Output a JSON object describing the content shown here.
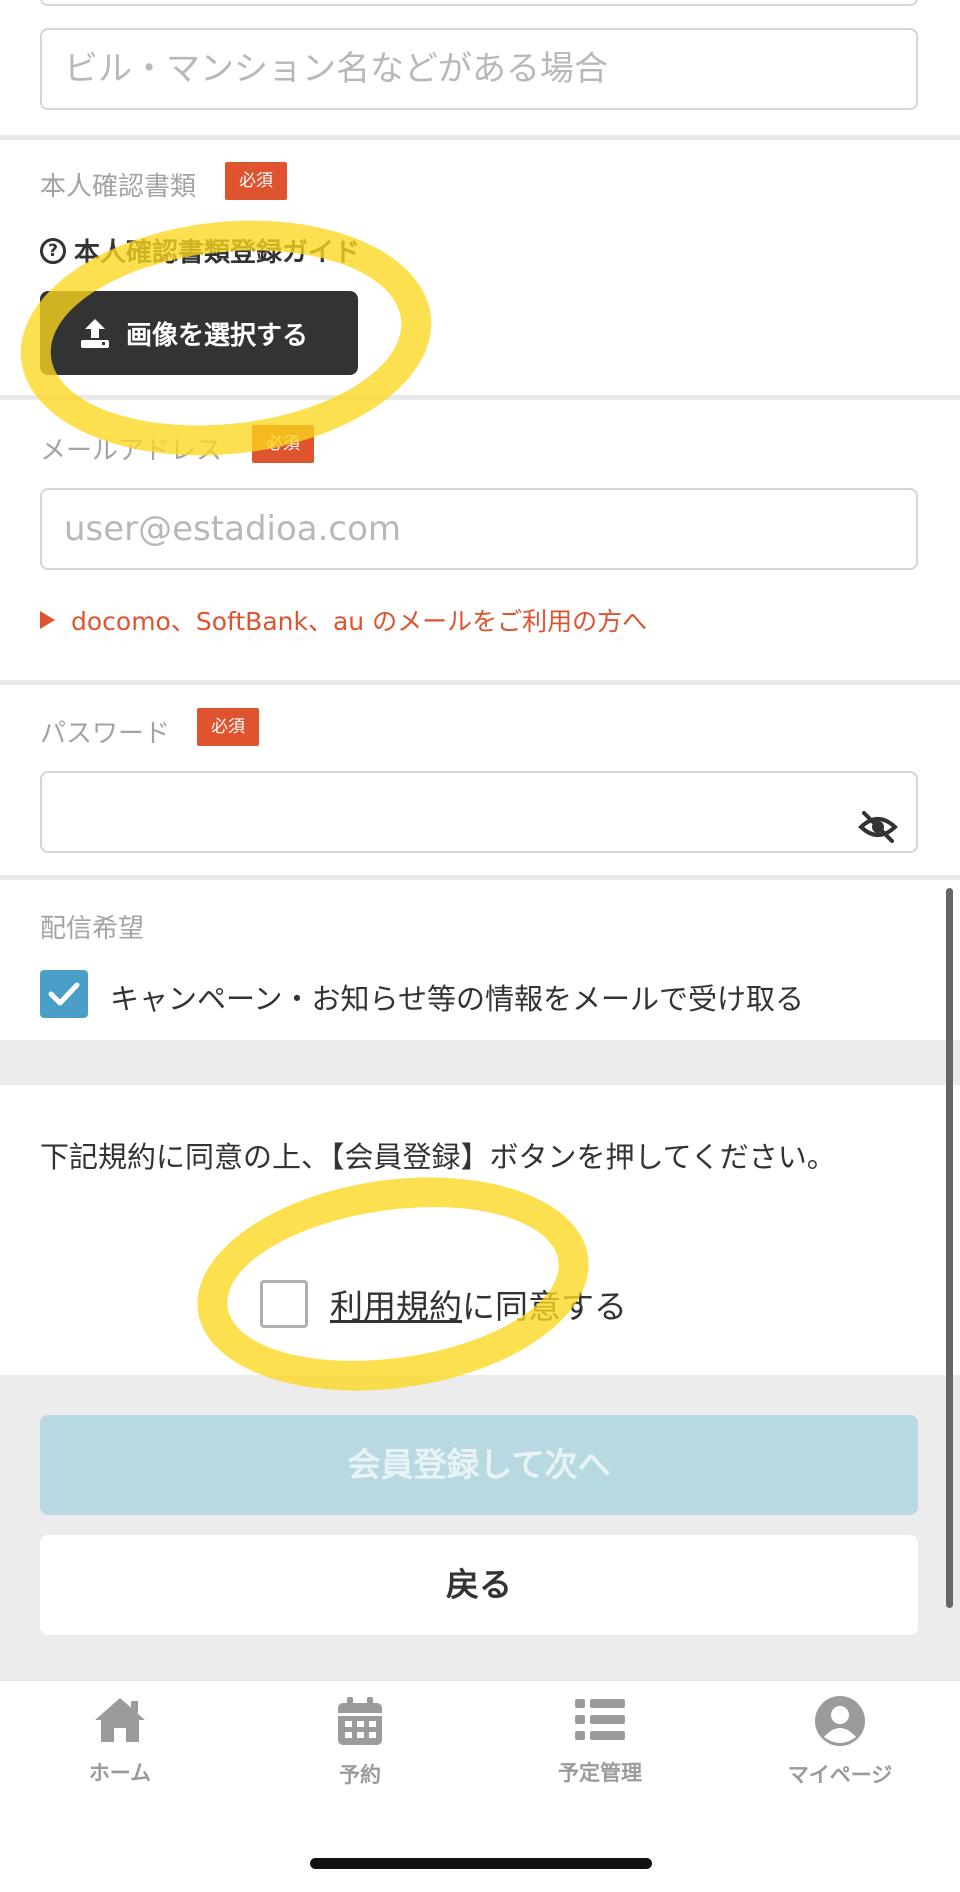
{
  "address": {
    "building_placeholder": "ビル・マンション名などがある場合"
  },
  "id_document": {
    "label": "本人確認書類",
    "required_badge": "必須",
    "guide_link": "本人確認書類登録ガイド",
    "upload_button": "画像を選択する"
  },
  "email": {
    "label": "メールアドレス",
    "required_badge": "必須",
    "placeholder": "user@estadioa.com",
    "carrier_note": "docomo、SoftBank、au のメールをご利用の方へ"
  },
  "password": {
    "label": "パスワード",
    "required_badge": "必須",
    "value": ""
  },
  "newsletter": {
    "label": "配信希望",
    "checkbox_label": "キャンペーン・お知らせ等の情報をメールで受け取る",
    "checked": true
  },
  "terms": {
    "instruction": "下記規約に同意の上、【会員登録】ボタンを押してください。",
    "agree_link": "利用規約",
    "agree_suffix": "に同意する",
    "checked": false
  },
  "actions": {
    "register_button": "会員登録して次へ",
    "back_button": "戻る"
  },
  "bottom_nav": [
    {
      "label": "ホーム",
      "icon": "home-icon"
    },
    {
      "label": "予約",
      "icon": "calendar-icon"
    },
    {
      "label": "予定管理",
      "icon": "list-icon"
    },
    {
      "label": "マイページ",
      "icon": "user-icon"
    }
  ],
  "colors": {
    "accent_red": "#e0532f",
    "checkbox_blue": "#4a9fc9",
    "disabled_button": "#b9d9e2",
    "dark_button": "#333333",
    "highlight_yellow": "#fcd71e"
  }
}
